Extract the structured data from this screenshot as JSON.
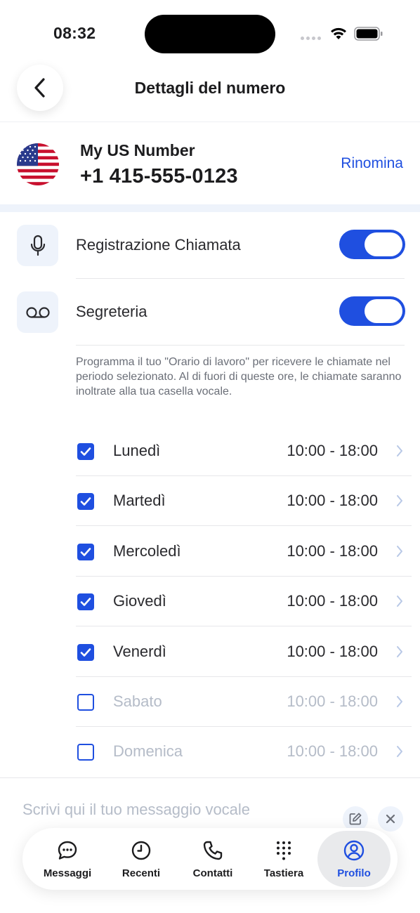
{
  "status_bar": {
    "time": "08:32"
  },
  "header": {
    "title": "Dettagli del numero"
  },
  "number": {
    "name": "My US Number",
    "phone": "+1 415-555-0123",
    "rename_label": "Rinomina"
  },
  "settings": {
    "call_recording": {
      "label": "Registrazione Chiamata",
      "enabled": true
    },
    "voicemail": {
      "label": "Segreteria",
      "enabled": true
    },
    "description": "Programma il tuo \"Orario di lavoro\" per ricevere le chiamate nel periodo selezionato. Al di fuori di queste ore, le chiamate saranno inoltrate alla tua casella vocale."
  },
  "days": [
    {
      "name": "Lunedì",
      "hours": "10:00 - 18:00",
      "checked": true
    },
    {
      "name": "Martedì",
      "hours": "10:00 - 18:00",
      "checked": true
    },
    {
      "name": "Mercoledì",
      "hours": "10:00 - 18:00",
      "checked": true
    },
    {
      "name": "Giovedì",
      "hours": "10:00 - 18:00",
      "checked": true
    },
    {
      "name": "Venerdì",
      "hours": "10:00 - 18:00",
      "checked": true
    },
    {
      "name": "Sabato",
      "hours": "10:00 - 18:00",
      "checked": false
    },
    {
      "name": "Domenica",
      "hours": "10:00 - 18:00",
      "checked": false
    }
  ],
  "voicemail_message": {
    "placeholder": "Scrivi qui il tuo messaggio vocale"
  },
  "tabs": [
    {
      "label": "Messaggi",
      "icon": "chat-bubble-icon"
    },
    {
      "label": "Recenti",
      "icon": "clock-icon"
    },
    {
      "label": "Contatti",
      "icon": "phone-icon"
    },
    {
      "label": "Tastiera",
      "icon": "keypad-icon"
    },
    {
      "label": "Profilo",
      "icon": "profile-icon",
      "active": true
    }
  ],
  "colors": {
    "accent": "#1f4fe0",
    "muted_text": "#b5bcc8",
    "icon_bg": "#eef3fb"
  }
}
